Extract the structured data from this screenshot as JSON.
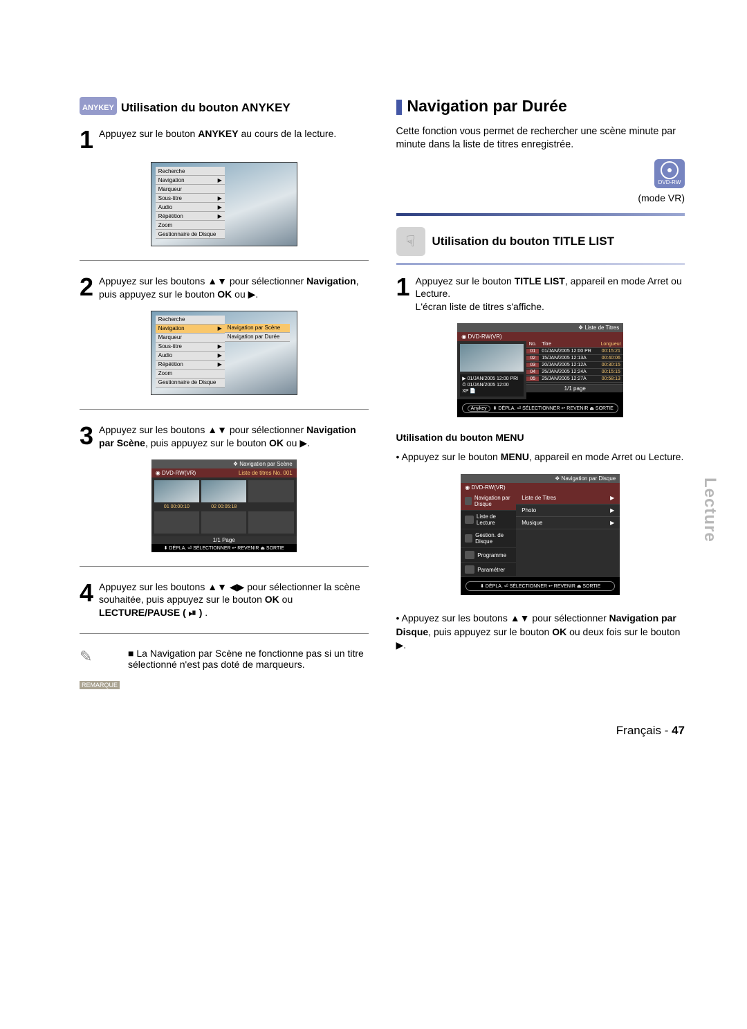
{
  "left": {
    "anykey_badge": "ANYKEY",
    "section_title": "Utilisation du bouton ANYKEY",
    "step1": {
      "num": "1",
      "t1": "Appuyez sur le bouton ",
      "b1": "ANYKEY",
      "t2": " au cours de la lecture."
    },
    "menu_items": [
      "Recherche",
      "Navigation",
      "Marqueur",
      "Sous-titre",
      "Audio",
      "Répétition",
      "Zoom",
      "Gestionnaire de Disque"
    ],
    "step2": {
      "num": "2",
      "t1": "Appuyez sur les boutons ▲▼ pour sélectionner ",
      "b1": "Navigation",
      "t2": ", puis appuyez sur le bouton ",
      "b2": "OK",
      "t3": " ou ▶."
    },
    "submenu": [
      "Navigation par Scène",
      "Navigation par Durée"
    ],
    "step3": {
      "num": "3",
      "t1": "Appuyez sur les boutons ▲▼ pour sélectionner ",
      "b1": "Navigation par Scène",
      "t2": ", puis appuyez sur le bouton ",
      "b2": "OK",
      "t3": " ou ▶."
    },
    "scene_screen": {
      "head": "❖  Navigation par Scène",
      "sub_l": "◉ DVD-RW(VR)",
      "sub_r": "Liste de titres No. 001",
      "c1": "01  00:00:10",
      "c2": "02  00:05:18",
      "page": "1/1 Page",
      "foot": "⬍ DÉPLA.   ⏎ SÉLECTIONNER   ↩ REVENIR   ⏏ SORTIE"
    },
    "step4": {
      "num": "4",
      "t1": "Appuyez sur les boutons ▲▼ ◀▶ pour sélectionner la scène souhaitée, puis appuyez sur le bouton ",
      "b1": "OK",
      "t2": " ou ",
      "b2": "LECTURE/PAUSE ( ⏯ )",
      "t3": " ."
    },
    "note": {
      "label": "REMARQUE",
      "text": "La Navigation par Scène ne fonctionne pas si un titre sélectionné n'est pas doté de marqueurs."
    }
  },
  "right": {
    "main_title": "Navigation par Durée",
    "intro": "Cette fonction vous permet de rechercher une scène minute par minute dans la liste de titres enregistrée.",
    "disc_label": "DVD-RW",
    "mode": "(mode VR)",
    "tl_section": "Utilisation du bouton TITLE LIST",
    "step1": {
      "num": "1",
      "t1": "Appuyez sur le bouton ",
      "b1": "TITLE LIST",
      "t2": ", appareil en mode Arret ou Lecture.",
      "t3": "L'écran liste de titres s'affiche."
    },
    "tlist": {
      "head": "❖  Liste de Titres",
      "sub": "◉ DVD-RW(VR)",
      "cols": [
        "No.",
        "Titre",
        "Longueur"
      ],
      "rows": [
        [
          "01",
          "01/JAN/2005 12:00 PR",
          "00:15:21"
        ],
        [
          "02",
          "15/JAN/2005 12:13A",
          "00:40:06"
        ],
        [
          "03",
          "20/JAN/2005 12:12A",
          "00:30:15"
        ],
        [
          "04",
          "25/JAN/2005 12:24A",
          "00:15:15"
        ],
        [
          "05",
          "25/JAN/2005 12:27A",
          "00:58:13"
        ]
      ],
      "info1": "▶ 01/JAN/2005 12:00 PRI",
      "info2": "⏱ 01/JAN/2005 12:00",
      "info3": "XP    📄",
      "page": "1/1 page",
      "foot_badge": "Anykey",
      "foot": "⬍ DÉPLA.   ⏎ SÉLECTIONNER   ↩ REVENIR   ⏏ SORTIE"
    },
    "menu_sub": "Utilisation du bouton MENU",
    "menu_p": {
      "t1": "Appuyez sur le bouton ",
      "b1": "MENU",
      "t2": ", appareil en mode Arret ou Lecture."
    },
    "discnav": {
      "head": "❖  Navigation par Disque",
      "sub": "◉ DVD-RW(VR)",
      "side": [
        {
          "l": "Navigation par Disque",
          "sel": true
        },
        {
          "l": "Liste de Lecture"
        },
        {
          "l": "Gestion. de Disque"
        },
        {
          "l": "Programme"
        },
        {
          "l": "Paramétrer"
        }
      ],
      "main": [
        {
          "l": "Liste de Titres",
          "sel": true
        },
        {
          "l": "Photo"
        },
        {
          "l": "Musique"
        }
      ],
      "foot": "⬍ DÉPLA.   ⏎ SÉLECTIONNER   ↩ REVENIR   ⏏ SORTIE"
    },
    "final_p": {
      "t1": "Appuyez sur les boutons ▲▼ pour sélectionner ",
      "b1": "Navigation par Disque",
      "t2": ", puis appuyez sur le bouton ",
      "b2": "OK",
      "t3": " ou deux fois sur le bouton ▶."
    }
  },
  "side_label": "Lecture",
  "footer": {
    "lang": "Français",
    "dash": " - ",
    "pg": "47"
  }
}
